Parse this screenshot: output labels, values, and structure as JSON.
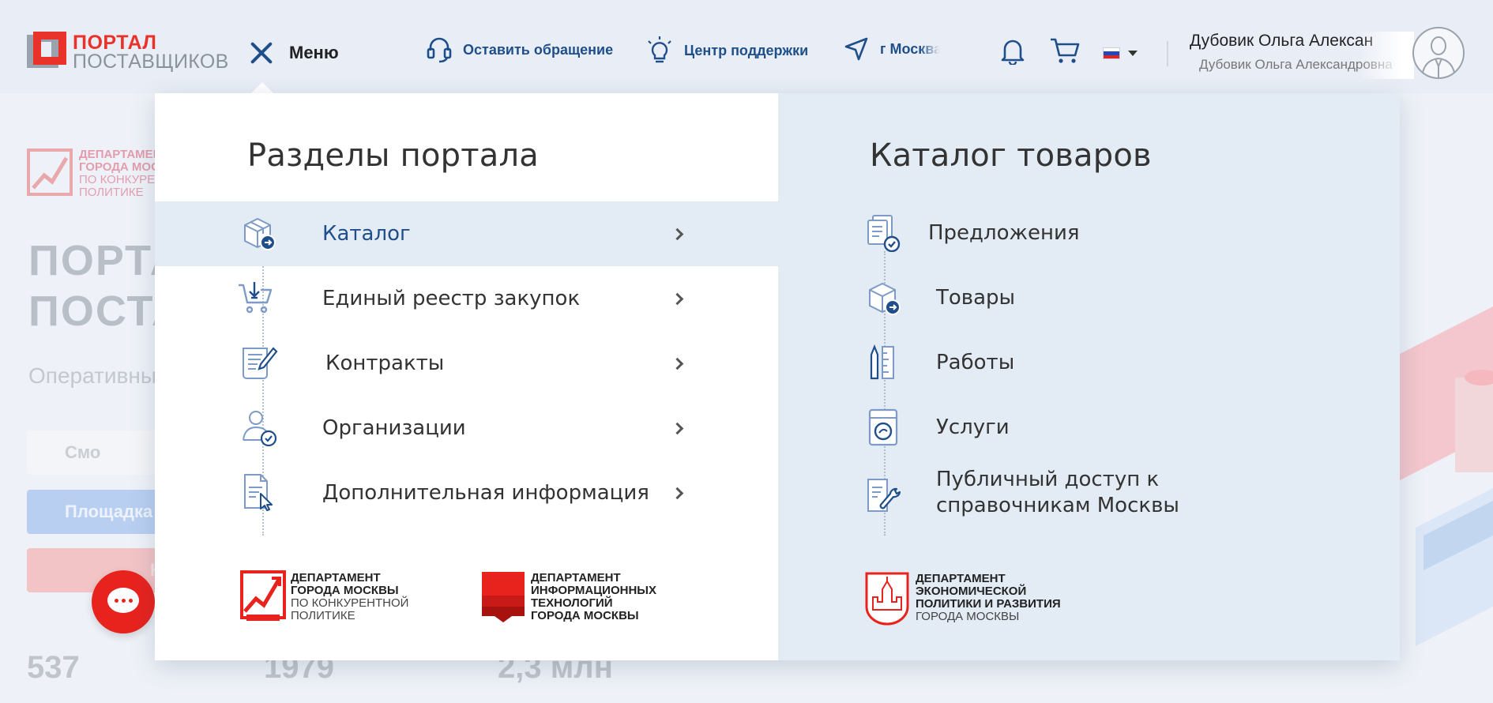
{
  "header": {
    "logo": {
      "line1": "ПОРТАЛ",
      "line2": "ПОСТАВЩИКОВ"
    },
    "menu_label": "Меню",
    "links": [
      {
        "label": "Оставить обращение",
        "icon": "headset-icon"
      },
      {
        "label": "Центр поддержки",
        "icon": "lightbulb-icon"
      },
      {
        "label": "г Москва",
        "icon": "location-arrow-icon"
      }
    ],
    "user": {
      "name_short": "Дубовик Ольга Алексан",
      "name_full": "Дубовик Ольга Александровна"
    },
    "colors": {
      "brand_red": "#e8322a",
      "accent_blue": "#1f4f8a"
    }
  },
  "menu": {
    "sections_title": "Разделы портала",
    "sections": [
      {
        "label": "Каталог",
        "icon": "box-icon",
        "active": true
      },
      {
        "label": "Единый реестр закупок",
        "icon": "cart-icon"
      },
      {
        "label": "Контракты",
        "icon": "contract-icon"
      },
      {
        "label": "Организации",
        "icon": "organization-icon"
      },
      {
        "label": "Дополнительная информация",
        "icon": "document-pointer-icon"
      }
    ],
    "catalog_title": "Каталог товаров",
    "catalog": [
      {
        "label": "Предложения",
        "icon": "offers-icon"
      },
      {
        "label": "Товары",
        "icon": "box-icon"
      },
      {
        "label": "Работы",
        "icon": "tools-icon"
      },
      {
        "label": "Услуги",
        "icon": "washer-icon"
      },
      {
        "label_line1": "Публичный доступ к",
        "label_line2": "справочникам Москвы",
        "icon": "wrench-doc-icon"
      }
    ],
    "departments": [
      {
        "l1": "ДЕПАРТАМЕНТ",
        "l2": "ГОРОДА МОСКВЫ",
        "l3": "ПО КОНКУРЕНТНОЙ",
        "l4": "ПОЛИТИКЕ"
      },
      {
        "l1": "ДЕПАРТАМЕНТ",
        "l2": "ИНФОРМАЦИОННЫХ",
        "l3": "ТЕХНОЛОГИЙ",
        "l4": "ГОРОДА МОСКВЫ"
      },
      {
        "l1": "ДЕПАРТАМЕНТ",
        "l2": "ЭКОНОМИЧЕСКОЙ",
        "l3": "ПОЛИТИКИ И РАЗВИТИЯ",
        "l4": "ГОРОДА МОСКВЫ"
      }
    ]
  },
  "background": {
    "dept": {
      "l1": "ДЕПАРТАМЕН",
      "l2": "ГОРОДА МОС",
      "l3": "ПО КОНКУРЕН",
      "l4": "ПОЛИТИКЕ"
    },
    "title_l1": "ПОРТА",
    "title_l2": "ПОСТА",
    "subtitle": "Оперативны",
    "btn1": "Смо",
    "btn2": "Площадка",
    "btn3": "Н",
    "stats": [
      "537",
      "1979",
      "2,3 млн"
    ]
  }
}
